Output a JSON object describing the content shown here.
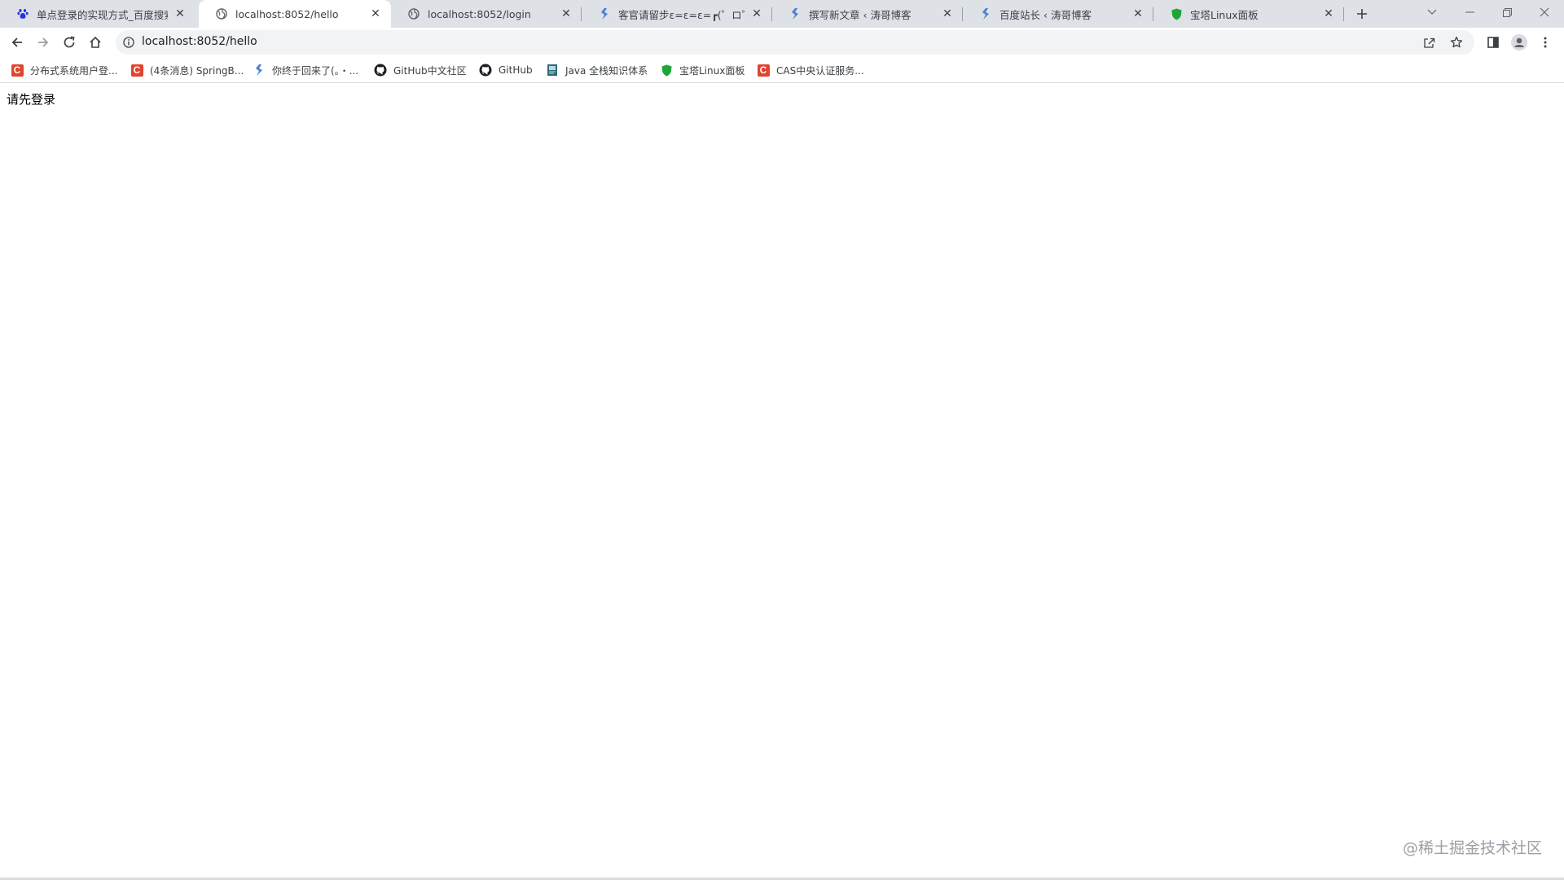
{
  "tabs": [
    {
      "title": "单点登录的实现方式_百度搜索",
      "icon": "baidu-paw-icon",
      "active": false
    },
    {
      "title": "localhost:8052/hello",
      "icon": "globe-icon",
      "active": true
    },
    {
      "title": "localhost:8052/login",
      "icon": "globe-icon",
      "active": false
    },
    {
      "title": "客官请留步ε=ε=ε=┏(゜ロ゜;)┛",
      "icon": "blog-icon",
      "active": false
    },
    {
      "title": "撰写新文章 ‹ 涛哥博客",
      "icon": "blog-icon",
      "active": false
    },
    {
      "title": "百度站长 ‹ 涛哥博客",
      "icon": "blog-icon",
      "active": false
    },
    {
      "title": "宝塔Linux面板",
      "icon": "bt-shield-icon",
      "active": false
    }
  ],
  "toolbar": {
    "url": "localhost:8052/hello"
  },
  "bookmarks": [
    {
      "label": "分布式系统用户登...",
      "icon": "csdn-icon"
    },
    {
      "label": "(4条消息) SpringB...",
      "icon": "csdn-icon"
    },
    {
      "label": "你终于回来了(。・...",
      "icon": "blog-icon"
    },
    {
      "label": "GitHub中文社区",
      "icon": "github-icon"
    },
    {
      "label": "GitHub",
      "icon": "github-icon"
    },
    {
      "label": "Java 全栈知识体系",
      "icon": "java-book-icon"
    },
    {
      "label": "宝塔Linux面板",
      "icon": "bt-shield-icon"
    },
    {
      "label": "CAS中央认证服务...",
      "icon": "csdn-icon"
    }
  ],
  "content": {
    "message": "请先登录"
  },
  "watermark": "@稀土掘金技术社区",
  "colors": {
    "tabstrip": "#dee1e6",
    "csdn_red": "#e1442e",
    "bt_green": "#20a53a"
  }
}
